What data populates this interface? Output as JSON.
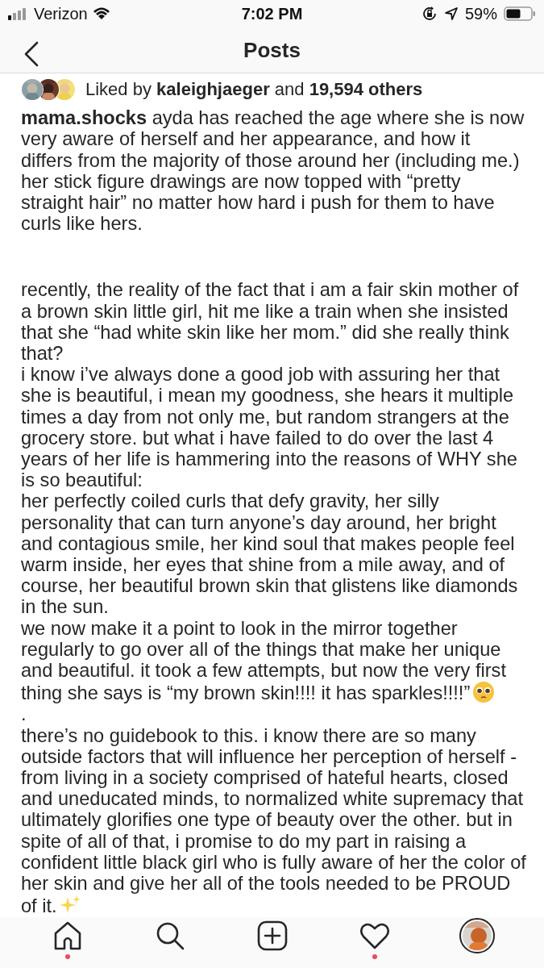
{
  "status_bar": {
    "carrier": "Verizon",
    "time": "7:02 PM",
    "battery": "59%"
  },
  "header": {
    "title": "Posts"
  },
  "likes": {
    "text": "Liked by **kaleighjaeger** and **19,594 others**"
  },
  "caption": {
    "username": "mama.shocks",
    "paragraphs": [
      {
        "text": "ayda has reached the age where she is now very aware of herself and her appearance, and how it differs from the majority of those around her (including me.) her stick figure drawings are now topped with “pretty straight hair” no matter how hard i push for them to have curls like hers."
      },
      {
        "text": "recently, the reality of the fact that i am a fair skin mother of a brown skin little girl, hit me like a train when she insisted that she “had white skin like her mom.” did she really think that?"
      },
      {
        "text": "i know i’ve always done a good job with assuring her that she is beautiful, i mean my goodness, she hears it multiple times a day from not only me, but random strangers at the grocery store. but what i have failed to do over the last 4 years of her life is hammering into the reasons of WHY she is so beautiful:"
      },
      {
        "text": "her perfectly coiled curls that defy gravity, her silly personality that can turn anyone’s day around, her bright and contagious smile, her kind soul that makes people feel warm inside, her eyes that shine from a mile away, and of course, her beautiful brown skin that glistens like diamonds in the sun."
      },
      {
        "text": "we now make it a point to look in the mirror together regularly to go over all of the things that make her unique and beautiful. it took a few attempts, but now the very first thing she says is “my brown skin!!!! it has sparkles!!!!”",
        "pleading_face_emoji": true
      },
      {
        "text": "."
      },
      {
        "text": "there’s no guidebook to this. i know there are so many outside factors that will influence her perception of herself - from living in a society comprised of hateful hearts, closed and uneducated minds, to normalized white supremacy that ultimately glorifies one type of beauty over the other. but in spite of all of that, i promise to do my part in raising a confident little black girl who is fully aware of her the color of her skin and give her all of the tools needed to be PROUD of it.",
        "sparkles_emoji": true
      }
    ]
  },
  "nav": [
    {
      "kind": "home",
      "notification": true
    },
    {
      "kind": "search",
      "notification": false
    },
    {
      "kind": "add",
      "notification": false
    },
    {
      "kind": "heart",
      "notification": true
    },
    {
      "kind": "profile",
      "notification": false
    }
  ]
}
